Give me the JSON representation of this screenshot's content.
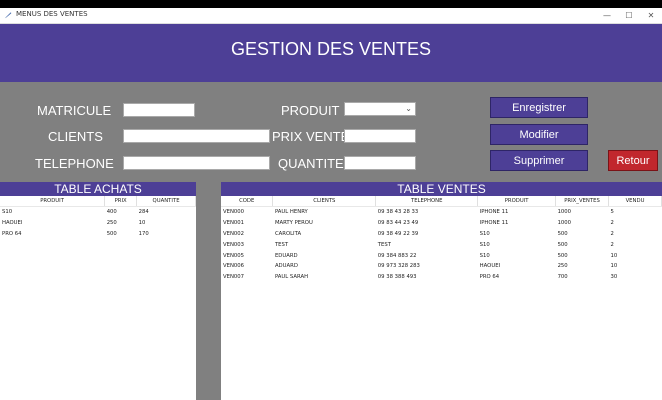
{
  "window": {
    "title": "MENUS DES VENTES",
    "minimize": "—",
    "maximize": "☐",
    "close": "✕"
  },
  "header": {
    "title": "GESTION DES VENTES"
  },
  "form": {
    "matricule_label": "MATRICULE",
    "clients_label": "CLIENTS",
    "telephone_label": "TELEPHONE",
    "produit_label": "PRODUIT",
    "prix_vente_label": "PRIX VENTE",
    "quantite_label": "QUANTITE",
    "produit_selected": ""
  },
  "buttons": {
    "enregistrer": "Enregistrer",
    "modifier": "Modifier",
    "supprimer": "Supprimer",
    "retour": "Retour"
  },
  "achats": {
    "title": "TABLE ACHATS",
    "columns": [
      "PRODUIT",
      "PRIX",
      "QUANTITE"
    ],
    "rows": [
      [
        "S10",
        "400",
        "284"
      ],
      [
        "HAOUEI",
        "250",
        "10"
      ],
      [
        "PRO 64",
        "500",
        "170"
      ]
    ]
  },
  "ventes": {
    "title": "TABLE VENTES",
    "columns": [
      "CODE",
      "CLIENTS",
      "TELEPHONE",
      "PRODUIT",
      "PRIX_VENTES",
      "VENDU"
    ],
    "rows": [
      [
        "VEN000",
        "PAUL HENRY",
        "09 38 43 28 33",
        "IPHONE 11",
        "1000",
        "5"
      ],
      [
        "VEN001",
        "MARTY PEROU",
        "09 83 44 23 49",
        "IPHONE 11",
        "1000",
        "2"
      ],
      [
        "VEN002",
        "CAROLITA",
        "09 38 49 22 39",
        "S10",
        "500",
        "2"
      ],
      [
        "VEN003",
        "TEST",
        "TEST",
        "S10",
        "500",
        "2"
      ],
      [
        "VEN005",
        "EDUARD",
        "09 384 883 22",
        "S10",
        "500",
        "10"
      ],
      [
        "VEN006",
        "ADUARD",
        "09 973 328 283",
        "HAOUEI",
        "250",
        "10"
      ],
      [
        "VEN007",
        "PAUL SARAH",
        "09 38 388 493",
        "PRO 64",
        "700",
        "30"
      ]
    ]
  }
}
